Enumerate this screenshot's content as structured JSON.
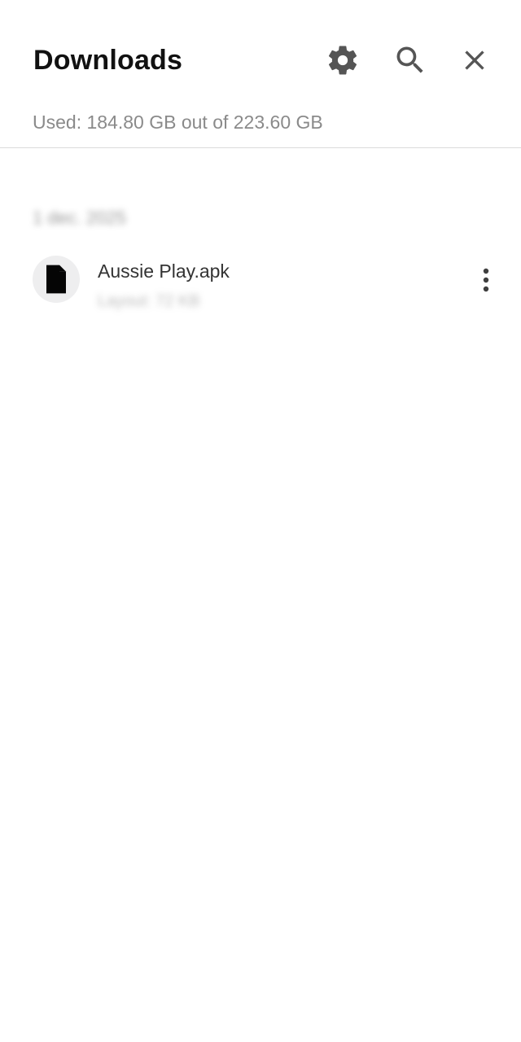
{
  "header": {
    "title": "Downloads",
    "icons": {
      "settings": "settings-gear",
      "search": "magnifier",
      "close": "close-x"
    },
    "storage_text": "Used: 184.80 GB out of 223.60 GB"
  },
  "downloads": {
    "date_header": "1 dec. 2025",
    "items": [
      {
        "file_name": "Aussie Play.apk",
        "meta": "Layout: 72 KB",
        "icon": "file-document",
        "menu_icon": "more-vertical"
      }
    ]
  },
  "colors": {
    "background": "#ffffff",
    "title": "#111111",
    "icon": "#555555",
    "secondary_text": "#8a8a8a",
    "divider": "#dcdcdc",
    "file_avatar_bg": "#eeeeef"
  }
}
